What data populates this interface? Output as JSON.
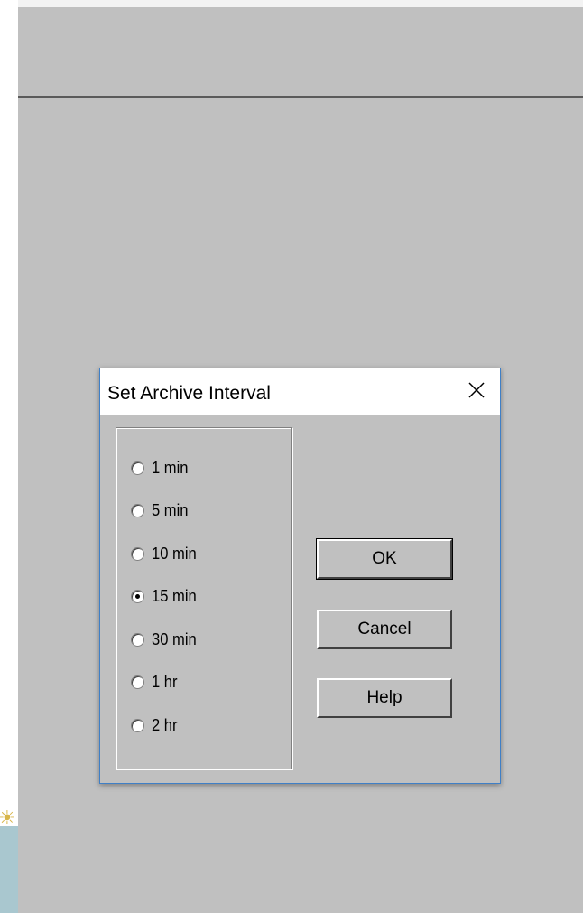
{
  "toolbar": {
    "buttons": [
      {
        "icon": "printer-icon"
      },
      {
        "icon": "help-icon"
      },
      {
        "icon": "close-icon"
      }
    ]
  },
  "dialog": {
    "title": "Set Archive Interval",
    "options": [
      {
        "label": "1 min",
        "checked": false
      },
      {
        "label": "5 min",
        "checked": false
      },
      {
        "label": "10 min",
        "checked": false
      },
      {
        "label": "15 min",
        "checked": true
      },
      {
        "label": "30 min",
        "checked": false
      },
      {
        "label": "1 hr",
        "checked": false
      },
      {
        "label": "2 hr",
        "checked": false
      }
    ],
    "ok_label": "OK",
    "cancel_label": "Cancel",
    "help_label": "Help"
  },
  "colors": {
    "window_bg": "#c0c0c0",
    "dialog_border": "#3f7fc6",
    "help_icon_blue": "#1f3fa6",
    "help_icon_yellow": "#f0e000"
  }
}
